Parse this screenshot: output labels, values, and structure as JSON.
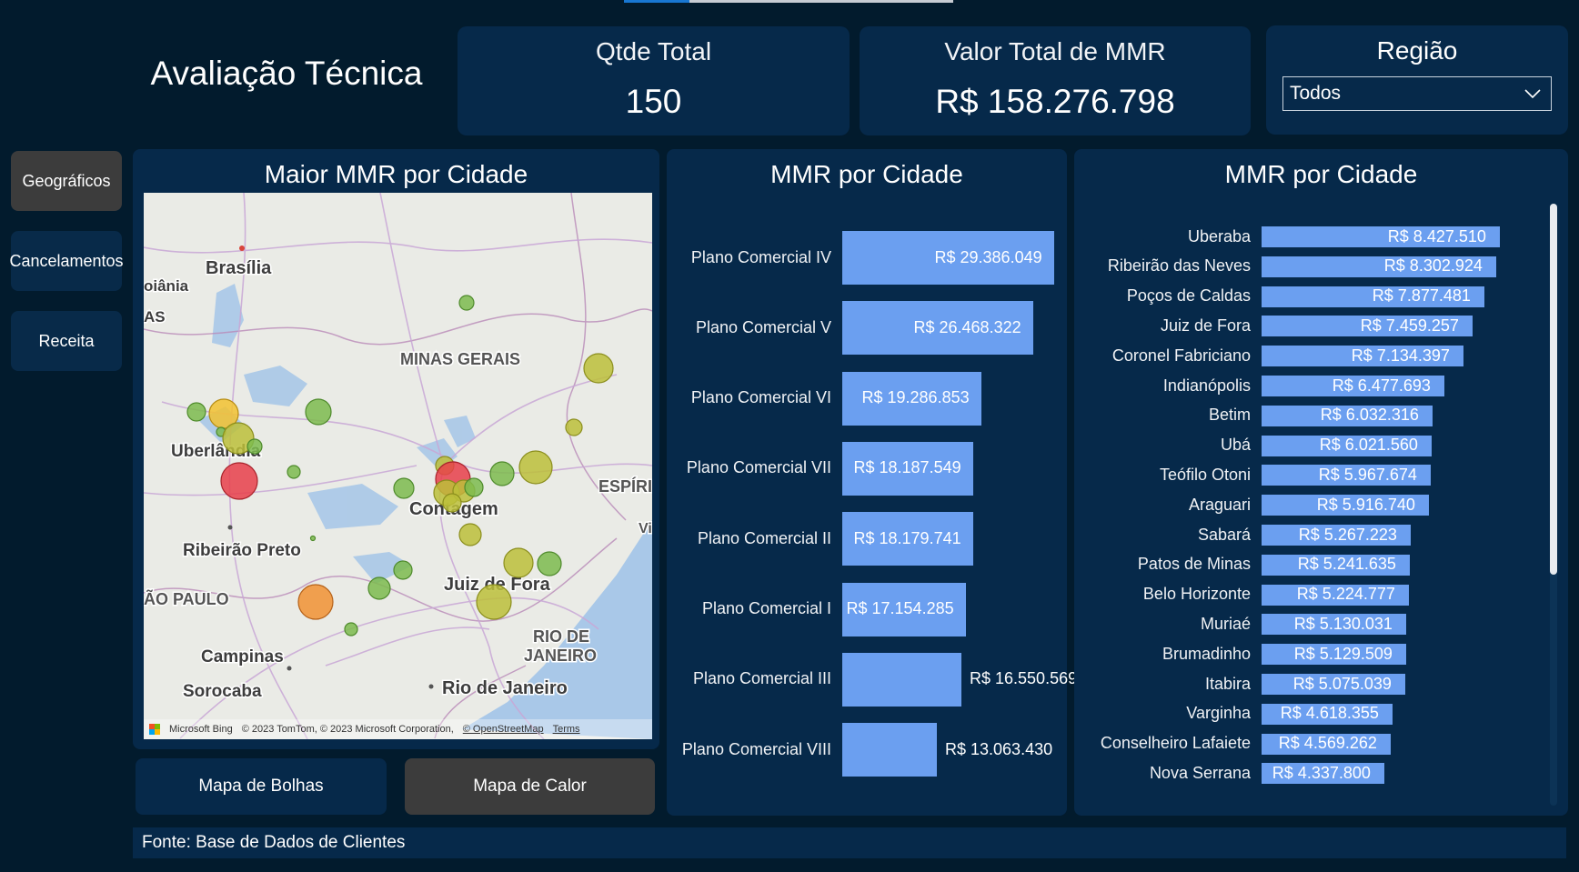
{
  "page_title": "Avaliação Técnica",
  "kpis": [
    {
      "label": "Qtde Total",
      "value": "150"
    },
    {
      "label": "Valor Total de MMR",
      "value": "R$ 158.276.798"
    }
  ],
  "region_filter": {
    "label": "Região",
    "selected": "Todos"
  },
  "nav": [
    {
      "label": "Geográficos",
      "active": true
    },
    {
      "label": "Cancelamentos",
      "active": false
    },
    {
      "label": "Receita",
      "active": false
    }
  ],
  "map_panel": {
    "title": "Maior MMR por Cidade",
    "labels": {
      "brasilia": "Brasília",
      "goiania": "oiânia",
      "as": "AS",
      "minas": "MINAS GERAIS",
      "uberlandia": "Uberlândia",
      "espirito": "ESPÍRI",
      "contagem": "Contagem",
      "ribeirao": "Ribeirão Preto",
      "juiz": "Juiz de Fora",
      "sao_paulo": "ÃO PAULO",
      "rio_state": "RIO DE",
      "rio_state2": "JANEIRO",
      "campinas": "Campinas",
      "sorocaba": "Sorocaba",
      "rio_city": "Rio de Janeiro",
      "vi": "Vi"
    },
    "attribution": {
      "brand": "Microsoft Bing",
      "text": "© 2023 TomTom, © 2023 Microsoft Corporation,",
      "osm": "© OpenStreetMap",
      "terms": "Terms"
    },
    "bubble_colors": {
      "green": "#7dbb4e",
      "olive": "#bcc03a",
      "yellow": "#f2c230",
      "orange": "#f19233",
      "red": "#e8404a"
    },
    "buttons": [
      {
        "label": "Mapa de Bolhas",
        "active": false
      },
      {
        "label": "Mapa de Calor",
        "active": true
      }
    ]
  },
  "chart_data": [
    {
      "type": "bar",
      "orientation": "horizontal",
      "title": "MMR por Cidade",
      "categories": [
        "Plano Comercial IV",
        "Plano Comercial V",
        "Plano Comercial VI",
        "Plano Comercial VII",
        "Plano Comercial II",
        "Plano Comercial I",
        "Plano Comercial III",
        "Plano Comercial VIII"
      ],
      "values": [
        29386049,
        26468322,
        19286853,
        18187549,
        18179741,
        17154285,
        16550569,
        13063430
      ],
      "value_labels": [
        "R$ 29.386.049",
        "R$ 26.468.322",
        "R$ 19.286.853",
        "R$ 18.187.549",
        "R$ 18.179.741",
        "R$ 17.154.285",
        "R$ 16.550.569",
        "R$ 13.063.430"
      ],
      "color": "#6b9ff0"
    },
    {
      "type": "bar",
      "orientation": "horizontal",
      "title": "MMR por Cidade",
      "categories": [
        "Uberaba",
        "Ribeirão das Neves",
        "Poços de Caldas",
        "Juiz de Fora",
        "Coronel Fabriciano",
        "Indianópolis",
        "Betim",
        "Ubá",
        "Teófilo Otoni",
        "Araguari",
        "Sabará",
        "Patos de Minas",
        "Belo Horizonte",
        "Muriaé",
        "Brumadinho",
        "Itabira",
        "Varginha",
        "Conselheiro Lafaiete",
        "Nova Serrana"
      ],
      "values": [
        8427510,
        8302924,
        7877481,
        7459257,
        7134397,
        6477693,
        6032316,
        6021560,
        5967674,
        5916740,
        5267223,
        5241635,
        5224777,
        5130031,
        5129509,
        5075039,
        4618355,
        4569262,
        4337800
      ],
      "value_labels": [
        "R$ 8.427.510",
        "R$ 8.302.924",
        "R$ 7.877.481",
        "R$ 7.459.257",
        "R$ 7.134.397",
        "R$ 6.477.693",
        "R$ 6.032.316",
        "R$ 6.021.560",
        "R$ 5.967.674",
        "R$ 5.916.740",
        "R$ 5.267.223",
        "R$ 5.241.635",
        "R$ 5.224.777",
        "R$ 5.130.031",
        "R$ 5.129.509",
        "R$ 5.075.039",
        "R$ 4.618.355",
        "R$ 4.569.262",
        "R$ 4.337.800"
      ],
      "color": "#6b9ff0"
    }
  ],
  "footer": "Fonte: Base de Dados de Clientes"
}
